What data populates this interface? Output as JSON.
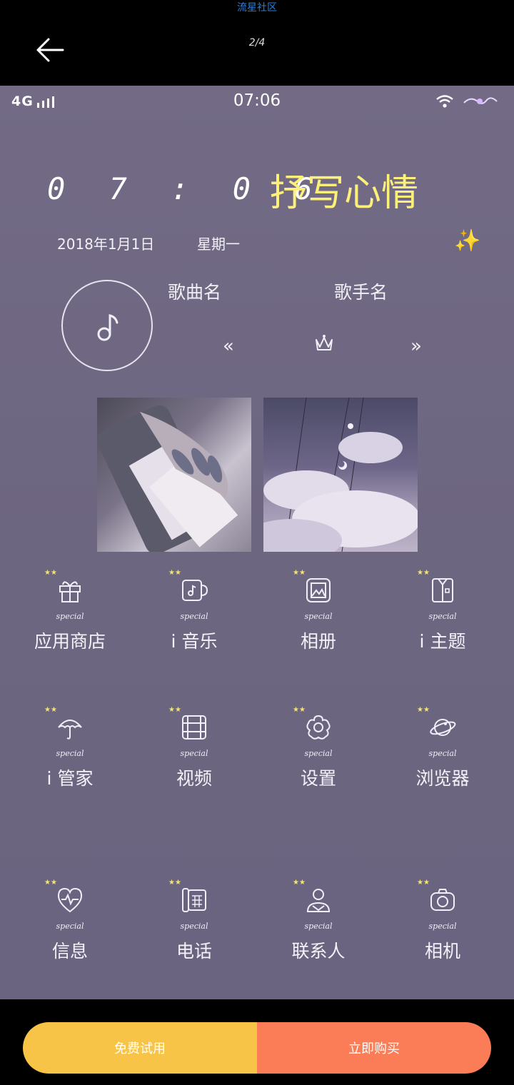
{
  "viewer": {
    "watermark": "流星社区",
    "page_indicator": "2/4"
  },
  "status_bar": {
    "network": "4G",
    "time": "07:06"
  },
  "widget": {
    "clock": "0 7 : 0 6",
    "mood_text": "抒写心情",
    "date": "2018年1月1日",
    "weekday": "星期一",
    "sparkle_icon": "✨"
  },
  "music": {
    "song_name": "歌曲名",
    "singer_name": "歌手名",
    "prev_icon": "«",
    "next_icon": "»"
  },
  "apps_badge": "special",
  "apps": [
    {
      "label": "应用商店",
      "icon": "gift-icon"
    },
    {
      "label": "i 音乐",
      "icon": "music-cup-icon"
    },
    {
      "label": "相册",
      "icon": "album-icon"
    },
    {
      "label": "i 主题",
      "icon": "shirt-icon"
    },
    {
      "label": "i 管家",
      "icon": "umbrella-icon"
    },
    {
      "label": "视频",
      "icon": "film-icon"
    },
    {
      "label": "设置",
      "icon": "flower-gear-icon"
    },
    {
      "label": "浏览器",
      "icon": "planet-icon"
    },
    {
      "label": "信息",
      "icon": "heart-pulse-icon"
    },
    {
      "label": "电话",
      "icon": "phone-icon"
    },
    {
      "label": "联系人",
      "icon": "person-icon"
    },
    {
      "label": "相机",
      "icon": "camera-icon"
    }
  ],
  "purchase": {
    "trial_label": "免费试用",
    "buy_label": "立即购买"
  },
  "colors": {
    "mood_text": "#fbf07a",
    "trial_button": "#f7c447",
    "buy_button": "#fb7d57",
    "screen_bg": "#6f6882"
  }
}
